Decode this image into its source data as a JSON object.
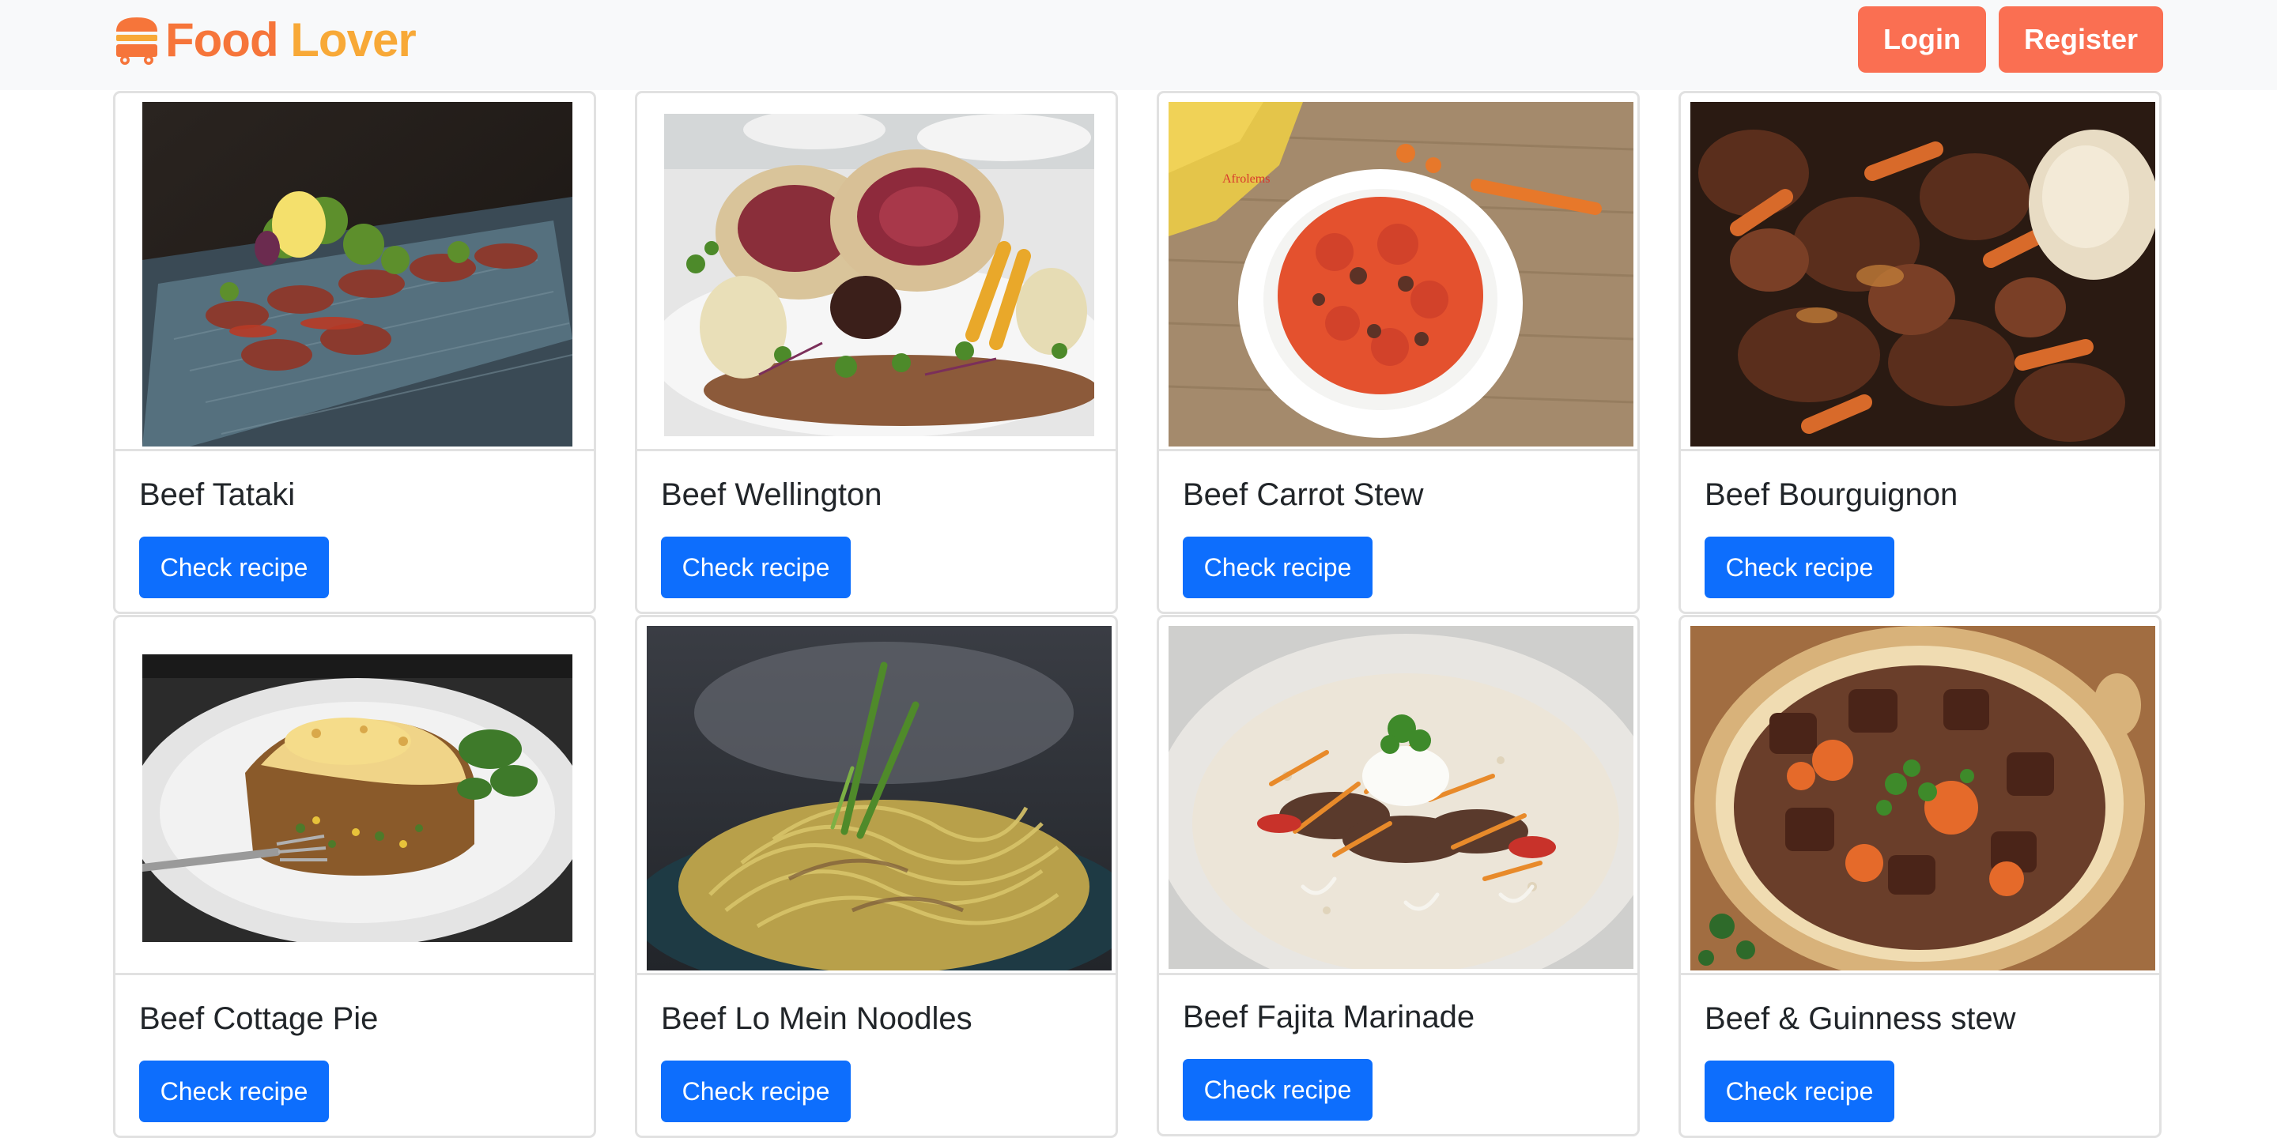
{
  "brand": {
    "word1": "Food",
    "word2": "Lover",
    "icon": "food-truck-icon",
    "color1": "#f6753a",
    "color2": "#f8a937"
  },
  "nav": {
    "login_label": "Login",
    "register_label": "Register",
    "accent": "#fa6f52"
  },
  "recipes": [
    {
      "title": "Beef Tataki",
      "button": "Check recipe",
      "image": "beef-tataki-photo"
    },
    {
      "title": "Beef Wellington",
      "button": "Check recipe",
      "image": "beef-wellington-photo"
    },
    {
      "title": "Beef Carrot Stew",
      "button": "Check recipe",
      "image": "beef-carrot-stew-photo",
      "image_caption": "Afrolems"
    },
    {
      "title": "Beef Bourguignon",
      "button": "Check recipe",
      "image": "beef-bourguignon-photo"
    },
    {
      "title": "Beef Cottage Pie",
      "button": "Check recipe",
      "image": "beef-cottage-pie-photo"
    },
    {
      "title": "Beef Lo Mein Noodles",
      "button": "Check recipe",
      "image": "beef-lo-mein-photo"
    },
    {
      "title": "Beef Fajita Marinade",
      "button": "Check recipe",
      "image": "beef-fajita-photo"
    },
    {
      "title": "Beef & Guinness stew",
      "button": "Check recipe",
      "image": "beef-guinness-stew-photo"
    }
  ],
  "colors": {
    "primary_button": "#0d6efd",
    "card_border": "#e1e1e1",
    "navbar_bg": "#f8f9fa"
  }
}
